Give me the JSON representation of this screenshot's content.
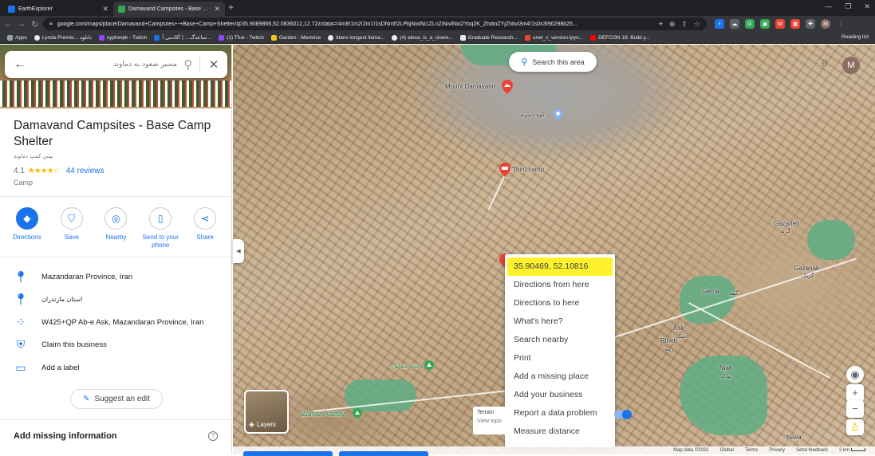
{
  "browser": {
    "tabs": [
      {
        "title": "EarthExplorer",
        "favicon_color": "#1a73e8"
      },
      {
        "title": "Damavand Campsites - Base Camp",
        "favicon_color": "#34a853"
      }
    ],
    "url": "google.com/maps/place/Damavand+Campsites+-+Base+Camp+Shelter/@35.9089866,52.0836012,12.72z/data=!4m8!1m2!2m1!1sDNmf!2LPbjNixlNi1ZLnZiNivlNio2Yoq2K_ZhdinZYjZhtivl3m4!1s0x3f90298b25...",
    "bookmarks": [
      {
        "label": "Apps",
        "color": "#9aa0a6"
      },
      {
        "label": "Lynda Premie... دانلود",
        "color": "#e8eaed"
      },
      {
        "label": "sypherpk - Twitch",
        "color": "#9146ff"
      },
      {
        "label": "ساعدگ... | آکادمی آ...",
        "color": "#1a73e8"
      },
      {
        "label": "(1) Tfue - Twitch",
        "color": "#9146ff"
      },
      {
        "label": "Garden - Memrise",
        "color": "#f5c518"
      },
      {
        "label": "titans longest llama...",
        "color": "#e8eaed"
      },
      {
        "label": "(4) alexa_is_a_clown...",
        "color": "#e8eaed"
      },
      {
        "label": "Graduate Research...",
        "color": "#e8eaed"
      },
      {
        "label": "unet_c_version.ipyn...",
        "color": "#e8eaed"
      },
      {
        "label": "DEFCON 19: Build y...",
        "color": "#ff0000"
      }
    ],
    "reading_list": "Reading list",
    "profile_initial": "M"
  },
  "panel": {
    "search_value": "مسیر صعود به دماوند",
    "title": "Damavand Campsites - Base Camp Shelter",
    "subtitle_fa": "بیس کمپ دماوند",
    "rating": "4.1",
    "stars": "★★★★☆",
    "reviews": "44 reviews",
    "category": "Camp",
    "actions": [
      {
        "label": "Directions",
        "icon": "◆"
      },
      {
        "label": "Save",
        "icon": "⛉"
      },
      {
        "label": "Nearby",
        "icon": "◎"
      },
      {
        "label": "Send to your phone",
        "icon": "▯"
      },
      {
        "label": "Share",
        "icon": "⋖"
      }
    ],
    "info": [
      {
        "text": "Mazandaran Province, Iran",
        "icon": "location-pin-icon",
        "glyph": "⬤"
      },
      {
        "text": "استان مازندران",
        "icon": "location-pin-icon",
        "glyph": "⬤"
      },
      {
        "text": "W425+QP Ab-e Ask, Mazandaran Province, Iran",
        "icon": "plus-code-icon",
        "glyph": "⁘"
      },
      {
        "text": "Claim this business",
        "icon": "verified-shield-icon",
        "glyph": "⛨"
      },
      {
        "text": "Add a label",
        "icon": "label-icon",
        "glyph": "▭"
      }
    ],
    "suggest_edit": "Suggest an edit",
    "add_missing": "Add missing information"
  },
  "map": {
    "search_this_area": "Search this area",
    "labels": {
      "mount_damavand": "Mount Damavand",
      "kooh_damavand": "کوه دماوند",
      "third_camp": "Third camp",
      "gazaneh_en": "Gazaneh",
      "gazaneh_fa": "گزنه",
      "gazanak_en": "Gazanak",
      "gazanak_fa": "گزنک",
      "gema_en": "Gema",
      "gema_fa": "گیما",
      "ask_en": "Ask",
      "ask_fa": "آسک",
      "rineh_en": "Rineh",
      "rineh_fa": "رینه",
      "niak_en": "Niak",
      "niak_fa": "نیاک",
      "zaman_valley": "Zaman Valley",
      "park_fa": "دشت شقایق",
      "nava": "Nava"
    },
    "context_menu": [
      "35.90469, 52.10816",
      "Directions from here",
      "Directions to here",
      "What's here?",
      "Search nearby",
      "Print",
      "Add a missing place",
      "Add your business",
      "Report a data problem",
      "Measure distance"
    ],
    "layers_label": "Layers",
    "terrain_label": "Terrain",
    "terrain_sub": "View topo",
    "footer": {
      "map_data": "Map data ©2022",
      "global": "Global",
      "terms": "Terms",
      "privacy": "Privacy",
      "send_feedback": "Send feedback",
      "scale": "2 km"
    },
    "colors": {
      "accent": "#1a73e8",
      "highlight": "#fff12b",
      "pin": "#ea4335",
      "park": "#34a853"
    }
  }
}
